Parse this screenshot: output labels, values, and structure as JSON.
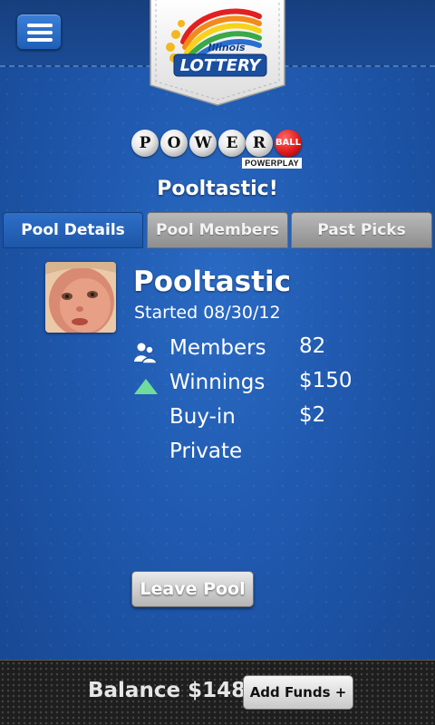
{
  "header": {
    "menu_icon": "hamburger-menu-icon",
    "logo_top_text": "Illinois",
    "logo_main_text": "LOTTERY"
  },
  "game_logo": {
    "letters": [
      "P",
      "O",
      "W",
      "E",
      "R"
    ],
    "ball_text": "BALL",
    "powerplay_text": "POWERPLAY"
  },
  "pool_title": "Pooltastic!",
  "tabs": [
    {
      "label": "Pool Details",
      "active": true
    },
    {
      "label": "Pool Members",
      "active": false
    },
    {
      "label": "Past Picks",
      "active": false
    }
  ],
  "pool": {
    "name": "Pooltastic",
    "started": "Started 08/30/12",
    "details": [
      {
        "label": "Members",
        "value": "82",
        "icon": "members-icon"
      },
      {
        "label": "Winnings",
        "value": "$150",
        "icon": "up-arrow-icon"
      },
      {
        "label": "Buy-in",
        "value": "$2",
        "icon": ""
      },
      {
        "label": "Private",
        "value": "",
        "icon": ""
      }
    ]
  },
  "actions": {
    "leave_pool": "Leave Pool"
  },
  "footer": {
    "balance": "Balance $148",
    "add_funds": "Add Funds +"
  },
  "colors": {
    "background": "#1f58ad",
    "active_tab": "#2e6fc8",
    "inactive_tab": "#a3a3a3",
    "winnings_arrow": "#6fdc9c"
  }
}
